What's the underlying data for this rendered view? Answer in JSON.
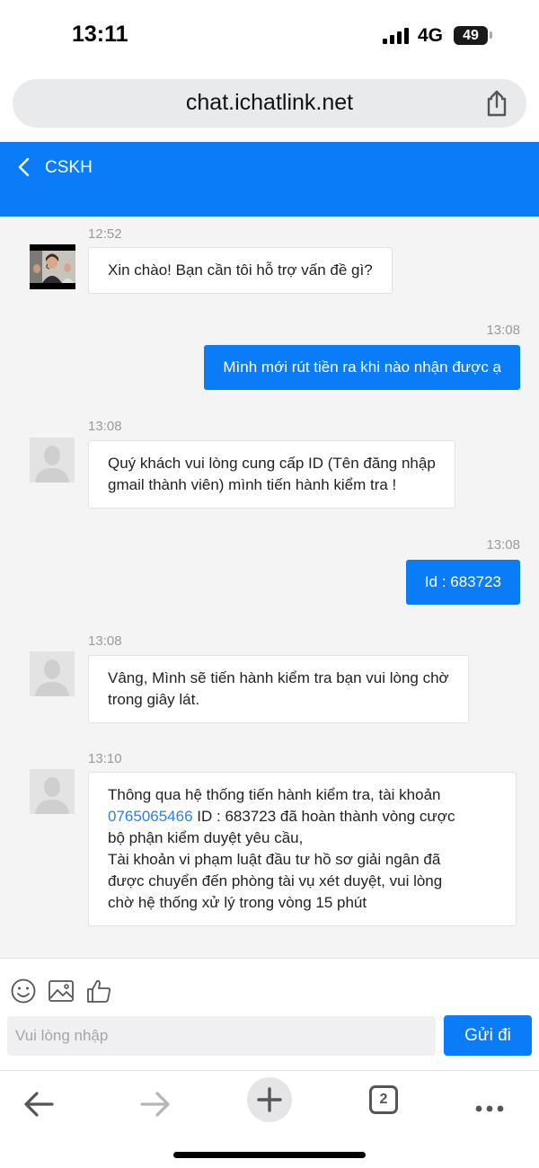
{
  "status_bar": {
    "time": "13:11",
    "network": "4G",
    "battery": "49"
  },
  "browser": {
    "url": "chat.ichatlink.net",
    "tab_count": "2"
  },
  "header": {
    "title": "CSKH"
  },
  "messages": [
    {
      "direction": "in",
      "time": "12:52",
      "avatar": "agent-photo",
      "text": "Xin chào! Bạn cần tôi hỗ trợ vấn đề gì?"
    },
    {
      "direction": "out",
      "time": "13:08",
      "text": "Mình mới rút tiền ra khi nào nhận được ạ"
    },
    {
      "direction": "in",
      "time": "13:08",
      "avatar": "default-avatar",
      "line1": "Quý khách vui lòng cung cấp ID (Tên đăng nhập",
      "line2": "gmail thành viên) mình tiến hành kiểm tra !"
    },
    {
      "direction": "out",
      "time": "13:08",
      "text": "Id : 683723"
    },
    {
      "direction": "in",
      "time": "13:08",
      "avatar": "default-avatar",
      "line1": "Vâng, Mình sẽ tiến hành kiểm tra bạn vui lòng chờ",
      "line2": "trong giây lát."
    },
    {
      "direction": "in",
      "time": "13:10",
      "avatar": "default-avatar",
      "line1": "Thông qua hệ thống tiến hành kiểm tra, tài khoản",
      "link": "0765065466",
      "line2_rest": " ID : 683723 đã hoàn thành vòng cược",
      "line3": "bộ phận kiểm duyệt yêu cầu,",
      "line4": "Tài khoản vi phạm luật đầu tư hồ sơ giải ngân đã",
      "line5": "được chuyển đến phòng tài vụ xét duyệt, vui lòng",
      "line6": "chờ hệ thống xử lý trong vòng 15 phút"
    }
  ],
  "composer": {
    "placeholder": "Vui lòng nhập",
    "send_label": "Gửi đi"
  },
  "colors": {
    "primary": "#0a7cf7",
    "chat_bg": "#f4f4f5",
    "link": "#2a80e8"
  }
}
